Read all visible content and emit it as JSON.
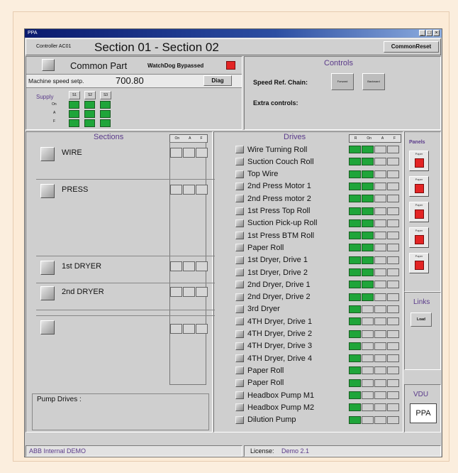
{
  "window": {
    "title": "PPA"
  },
  "header": {
    "controller_label": "Controller AC01",
    "section_title": "Section 01 - Section 02",
    "common_reset": "CommonReset"
  },
  "common": {
    "title": "Common Part",
    "watchdog_label": "WatchDog Bypassed",
    "speed_label": "Machine speed setp.",
    "speed_value": "700.80",
    "diag_button": "Diag",
    "supply_label": "Supply",
    "supply_row_labels": [
      "On",
      "A",
      "F"
    ],
    "supply_columns": [
      "S1",
      "S2",
      "S3"
    ]
  },
  "controls": {
    "title": "Controls",
    "speed_ref_label": "Speed Ref. Chain:",
    "speed_ref_buttons": [
      "Forward",
      "Backward"
    ],
    "extra_label": "Extra controls:"
  },
  "sections": {
    "title": "Sections",
    "indicator_headers": [
      "On",
      "A",
      "F"
    ],
    "items": [
      {
        "label": "WIRE"
      },
      {
        "label": "PRESS"
      },
      {
        "label": "1st DRYER"
      },
      {
        "label": "2nd DRYER"
      },
      {
        "label": ""
      }
    ],
    "pump_label": "Pump Drives :"
  },
  "drives": {
    "title": "Drives",
    "indicator_headers": [
      "R",
      "On",
      "A",
      "F"
    ],
    "items": [
      {
        "name": "Wire Turning Roll",
        "state": [
          1,
          1,
          0,
          0
        ]
      },
      {
        "name": "Suction Couch Roll",
        "state": [
          1,
          1,
          0,
          0
        ]
      },
      {
        "name": "Top Wire",
        "state": [
          1,
          1,
          0,
          0
        ]
      },
      {
        "name": "2nd Press Motor 1",
        "state": [
          1,
          1,
          0,
          0
        ]
      },
      {
        "name": "2nd Press motor 2",
        "state": [
          1,
          1,
          0,
          0
        ]
      },
      {
        "name": "1st Press Top Roll",
        "state": [
          1,
          1,
          0,
          0
        ]
      },
      {
        "name": "Suction Pick-up Roll",
        "state": [
          1,
          1,
          0,
          0
        ]
      },
      {
        "name": "1st Press BTM Roll",
        "state": [
          1,
          1,
          0,
          0
        ]
      },
      {
        "name": "Paper Roll",
        "state": [
          1,
          1,
          0,
          0
        ]
      },
      {
        "name": "1st Dryer, Drive 1",
        "state": [
          1,
          1,
          0,
          0
        ]
      },
      {
        "name": "1st Dryer, Drive 2",
        "state": [
          1,
          1,
          0,
          0
        ]
      },
      {
        "name": "2nd Dryer, Drive 1",
        "state": [
          1,
          1,
          0,
          0
        ]
      },
      {
        "name": "2nd Dryer, Drive 2",
        "state": [
          1,
          1,
          0,
          0
        ]
      },
      {
        "name": "3rd Dryer",
        "state": [
          1,
          0,
          0,
          0
        ]
      },
      {
        "name": "4TH Dryer, Drive 1",
        "state": [
          1,
          0,
          0,
          0
        ]
      },
      {
        "name": "4TH Dryer, Drive 2",
        "state": [
          1,
          0,
          0,
          0
        ]
      },
      {
        "name": "4TH Dryer, Drive 3",
        "state": [
          1,
          0,
          0,
          0
        ]
      },
      {
        "name": "4TH Dryer, Drive 4",
        "state": [
          1,
          0,
          0,
          0
        ]
      },
      {
        "name": "Paper Roll",
        "state": [
          1,
          0,
          0,
          0
        ]
      },
      {
        "name": "Paper Roll",
        "state": [
          1,
          0,
          0,
          0
        ]
      },
      {
        "name": "Headbox Pump M1",
        "state": [
          1,
          0,
          0,
          0
        ]
      },
      {
        "name": "Headbox Pump M2",
        "state": [
          1,
          0,
          0,
          0
        ]
      },
      {
        "name": "Dilution Pump",
        "state": [
          1,
          0,
          0,
          0
        ]
      }
    ]
  },
  "panels": {
    "title": "Panels",
    "items": [
      "Paper",
      "Paper",
      "Paper",
      "Paper",
      "Paper"
    ]
  },
  "links": {
    "title": "Links",
    "button": "Load"
  },
  "vdu": {
    "title": "VDU",
    "button": "PPA"
  },
  "status": {
    "left": "ABB Internal DEMO",
    "license_label": "License:",
    "license_value": "Demo 2.1"
  },
  "colors": {
    "green": "#1fa53a",
    "red": "#e32424",
    "title_purple": "#5a3a8a"
  }
}
